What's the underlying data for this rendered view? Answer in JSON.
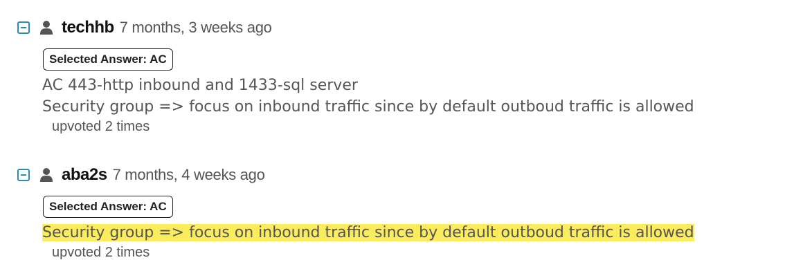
{
  "comments": [
    {
      "username": "techhb",
      "timestamp": "7 months, 3 weeks ago",
      "badge": "Selected Answer: AC",
      "lines": [
        "AC 443-http inbound and 1433-sql server",
        "Security group => focus on inbound traffic since by default outboud traffic is allowed"
      ],
      "votes": "upvoted 2 times",
      "highlighted": false
    },
    {
      "username": "aba2s",
      "timestamp": "7 months, 4 weeks ago",
      "badge": "Selected Answer: AC",
      "lines": [
        "Security group => focus on inbound traffic since by default outboud traffic is allowed"
      ],
      "votes": "upvoted 2 times",
      "highlighted": true
    }
  ],
  "colors": {
    "collapse_accent": "#2c8ab8",
    "highlight": "#fbec5d",
    "username": "#111111",
    "text": "#555555"
  },
  "icons": {
    "collapse": "minus-square-icon",
    "user": "user-icon"
  }
}
